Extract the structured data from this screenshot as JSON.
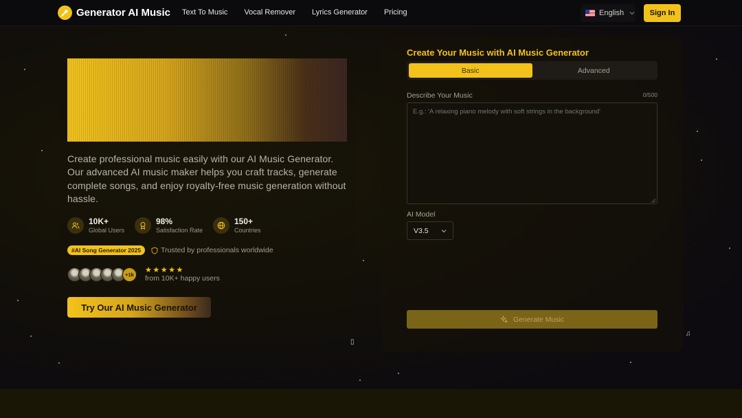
{
  "nav": {
    "brand": "Generator AI Music",
    "links": [
      "Text To Music",
      "Vocal Remover",
      "Lyrics Generator",
      "Pricing"
    ],
    "language": "English",
    "sign_in": "Sign In"
  },
  "hero": {
    "description": "Create professional music easily with our AI Music Generator. Our advanced AI music maker helps you craft tracks, generate complete songs, and enjoy royalty-free music generation without hassle.",
    "stats": [
      {
        "value": "10K+",
        "label": "Global Users",
        "icon": "users-icon"
      },
      {
        "value": "98%",
        "label": "Satisfaction Rate",
        "icon": "award-icon"
      },
      {
        "value": "150+",
        "label": "Countries",
        "icon": "globe-icon"
      }
    ],
    "badge": "#AI Song Generator 2025",
    "trusted": "Trusted by professionals worldwide",
    "avatars_more": "+1k",
    "rating_stars": "★★★★★",
    "rating_text": "from 10K+ happy users",
    "cta": "Try Our AI Music Generator"
  },
  "form": {
    "title": "Create Your Music with AI Music Generator",
    "tabs": [
      "Basic",
      "Advanced"
    ],
    "active_tab": "Basic",
    "describe_label": "Describe Your Music",
    "counter": "0/500",
    "placeholder": "E.g.: 'A relaxing piano melody with soft strings in the background'",
    "value": "",
    "model_label": "AI Model",
    "model_value": "V3.5",
    "generate": "Generate Music"
  },
  "colors": {
    "accent": "#f2c21b",
    "background": "#0d0b0f"
  }
}
